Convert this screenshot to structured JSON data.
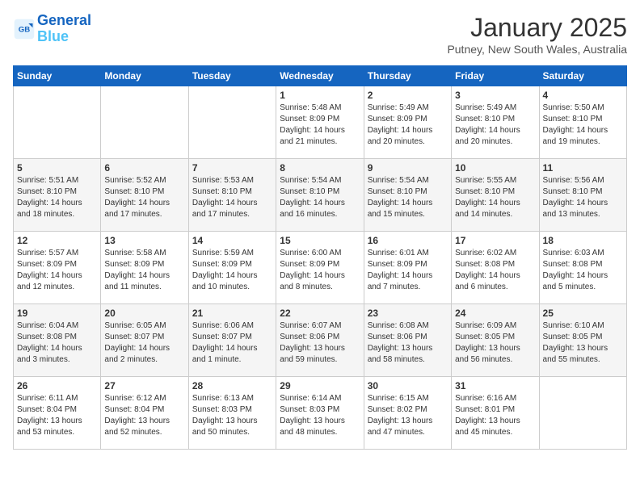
{
  "header": {
    "logo_line1": "General",
    "logo_line2": "Blue",
    "month": "January 2025",
    "location": "Putney, New South Wales, Australia"
  },
  "days_of_week": [
    "Sunday",
    "Monday",
    "Tuesday",
    "Wednesday",
    "Thursday",
    "Friday",
    "Saturday"
  ],
  "weeks": [
    [
      {
        "day": "",
        "content": ""
      },
      {
        "day": "",
        "content": ""
      },
      {
        "day": "",
        "content": ""
      },
      {
        "day": "1",
        "content": "Sunrise: 5:48 AM\nSunset: 8:09 PM\nDaylight: 14 hours\nand 21 minutes."
      },
      {
        "day": "2",
        "content": "Sunrise: 5:49 AM\nSunset: 8:09 PM\nDaylight: 14 hours\nand 20 minutes."
      },
      {
        "day": "3",
        "content": "Sunrise: 5:49 AM\nSunset: 8:10 PM\nDaylight: 14 hours\nand 20 minutes."
      },
      {
        "day": "4",
        "content": "Sunrise: 5:50 AM\nSunset: 8:10 PM\nDaylight: 14 hours\nand 19 minutes."
      }
    ],
    [
      {
        "day": "5",
        "content": "Sunrise: 5:51 AM\nSunset: 8:10 PM\nDaylight: 14 hours\nand 18 minutes."
      },
      {
        "day": "6",
        "content": "Sunrise: 5:52 AM\nSunset: 8:10 PM\nDaylight: 14 hours\nand 17 minutes."
      },
      {
        "day": "7",
        "content": "Sunrise: 5:53 AM\nSunset: 8:10 PM\nDaylight: 14 hours\nand 17 minutes."
      },
      {
        "day": "8",
        "content": "Sunrise: 5:54 AM\nSunset: 8:10 PM\nDaylight: 14 hours\nand 16 minutes."
      },
      {
        "day": "9",
        "content": "Sunrise: 5:54 AM\nSunset: 8:10 PM\nDaylight: 14 hours\nand 15 minutes."
      },
      {
        "day": "10",
        "content": "Sunrise: 5:55 AM\nSunset: 8:10 PM\nDaylight: 14 hours\nand 14 minutes."
      },
      {
        "day": "11",
        "content": "Sunrise: 5:56 AM\nSunset: 8:10 PM\nDaylight: 14 hours\nand 13 minutes."
      }
    ],
    [
      {
        "day": "12",
        "content": "Sunrise: 5:57 AM\nSunset: 8:09 PM\nDaylight: 14 hours\nand 12 minutes."
      },
      {
        "day": "13",
        "content": "Sunrise: 5:58 AM\nSunset: 8:09 PM\nDaylight: 14 hours\nand 11 minutes."
      },
      {
        "day": "14",
        "content": "Sunrise: 5:59 AM\nSunset: 8:09 PM\nDaylight: 14 hours\nand 10 minutes."
      },
      {
        "day": "15",
        "content": "Sunrise: 6:00 AM\nSunset: 8:09 PM\nDaylight: 14 hours\nand 8 minutes."
      },
      {
        "day": "16",
        "content": "Sunrise: 6:01 AM\nSunset: 8:09 PM\nDaylight: 14 hours\nand 7 minutes."
      },
      {
        "day": "17",
        "content": "Sunrise: 6:02 AM\nSunset: 8:08 PM\nDaylight: 14 hours\nand 6 minutes."
      },
      {
        "day": "18",
        "content": "Sunrise: 6:03 AM\nSunset: 8:08 PM\nDaylight: 14 hours\nand 5 minutes."
      }
    ],
    [
      {
        "day": "19",
        "content": "Sunrise: 6:04 AM\nSunset: 8:08 PM\nDaylight: 14 hours\nand 3 minutes."
      },
      {
        "day": "20",
        "content": "Sunrise: 6:05 AM\nSunset: 8:07 PM\nDaylight: 14 hours\nand 2 minutes."
      },
      {
        "day": "21",
        "content": "Sunrise: 6:06 AM\nSunset: 8:07 PM\nDaylight: 14 hours\nand 1 minute."
      },
      {
        "day": "22",
        "content": "Sunrise: 6:07 AM\nSunset: 8:06 PM\nDaylight: 13 hours\nand 59 minutes."
      },
      {
        "day": "23",
        "content": "Sunrise: 6:08 AM\nSunset: 8:06 PM\nDaylight: 13 hours\nand 58 minutes."
      },
      {
        "day": "24",
        "content": "Sunrise: 6:09 AM\nSunset: 8:05 PM\nDaylight: 13 hours\nand 56 minutes."
      },
      {
        "day": "25",
        "content": "Sunrise: 6:10 AM\nSunset: 8:05 PM\nDaylight: 13 hours\nand 55 minutes."
      }
    ],
    [
      {
        "day": "26",
        "content": "Sunrise: 6:11 AM\nSunset: 8:04 PM\nDaylight: 13 hours\nand 53 minutes."
      },
      {
        "day": "27",
        "content": "Sunrise: 6:12 AM\nSunset: 8:04 PM\nDaylight: 13 hours\nand 52 minutes."
      },
      {
        "day": "28",
        "content": "Sunrise: 6:13 AM\nSunset: 8:03 PM\nDaylight: 13 hours\nand 50 minutes."
      },
      {
        "day": "29",
        "content": "Sunrise: 6:14 AM\nSunset: 8:03 PM\nDaylight: 13 hours\nand 48 minutes."
      },
      {
        "day": "30",
        "content": "Sunrise: 6:15 AM\nSunset: 8:02 PM\nDaylight: 13 hours\nand 47 minutes."
      },
      {
        "day": "31",
        "content": "Sunrise: 6:16 AM\nSunset: 8:01 PM\nDaylight: 13 hours\nand 45 minutes."
      },
      {
        "day": "",
        "content": ""
      }
    ]
  ]
}
